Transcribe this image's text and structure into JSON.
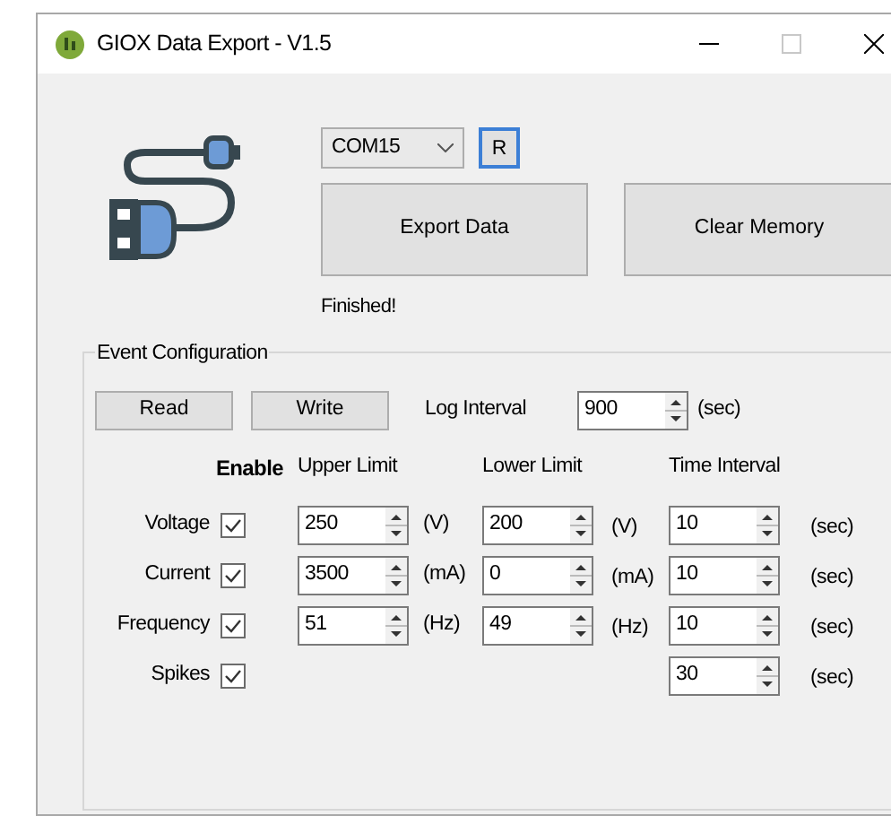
{
  "window": {
    "title": "GIOX Data Export - V1.5"
  },
  "port": {
    "value": "COM15"
  },
  "refresh_button": "R",
  "export_button": "Export Data",
  "clear_button": "Clear Memory",
  "status": "Finished!",
  "event_configuration": {
    "title": "Event Configuration",
    "read_button": "Read",
    "write_button": "Write",
    "log_interval": {
      "label": "Log Interval",
      "value": "900",
      "unit": "(sec)"
    },
    "headers": [
      "Enable",
      "Upper Limit",
      "Lower Limit",
      "Time Interval"
    ],
    "rows": [
      {
        "label": "Voltage",
        "enabled": true,
        "upper": {
          "value": "250",
          "unit": "(V)"
        },
        "lower": {
          "value": "200",
          "unit": "(V)"
        },
        "time": {
          "value": "10",
          "unit": "(sec)"
        }
      },
      {
        "label": "Current",
        "enabled": true,
        "upper": {
          "value": "3500",
          "unit": "(mA)"
        },
        "lower": {
          "value": "0",
          "unit": "(mA)"
        },
        "time": {
          "value": "10",
          "unit": "(sec)"
        }
      },
      {
        "label": "Frequency",
        "enabled": true,
        "upper": {
          "value": "51",
          "unit": "(Hz)"
        },
        "lower": {
          "value": "49",
          "unit": "(Hz)"
        },
        "time": {
          "value": "10",
          "unit": "(sec)"
        }
      },
      {
        "label": "Spikes",
        "enabled": true,
        "time": {
          "value": "30",
          "unit": "(sec)"
        }
      }
    ]
  }
}
